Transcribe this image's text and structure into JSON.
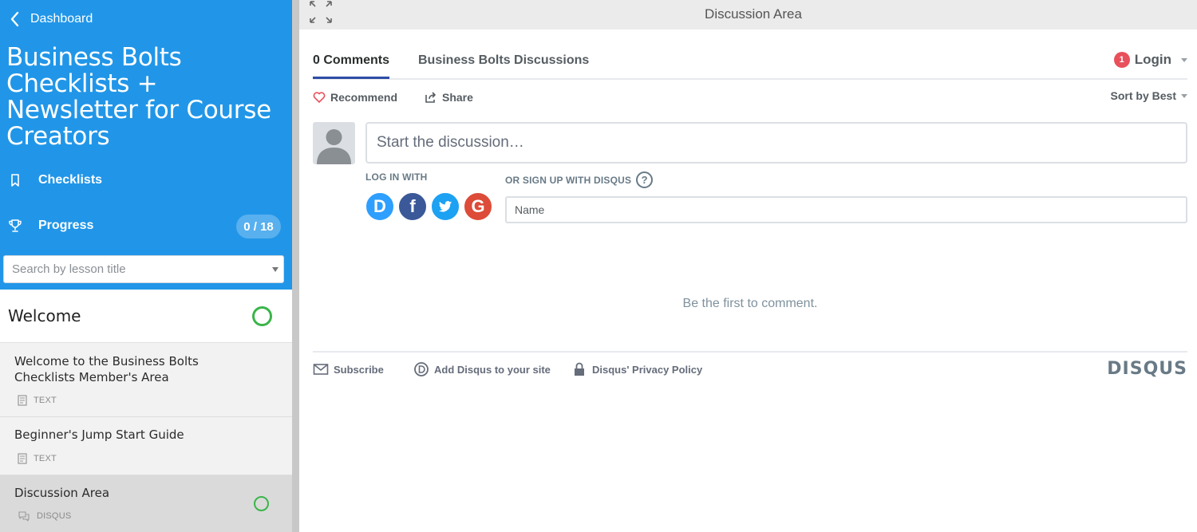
{
  "sidebar": {
    "back_label": "Dashboard",
    "course_title": "Business Bolts Checklists + Newsletter for Course Creators",
    "nav": {
      "checklists": "Checklists",
      "progress": "Progress",
      "progress_count": "0 / 18"
    },
    "search_placeholder": "Search by lesson title",
    "section": {
      "title": "Welcome"
    },
    "lessons": [
      {
        "title": "Welcome to the Business Bolts Checklists Member's Area",
        "type": "TEXT"
      },
      {
        "title": "Beginner's Jump Start Guide",
        "type": "TEXT"
      },
      {
        "title": "Discussion Area",
        "type": "DISQUS",
        "active": true
      }
    ],
    "colors": {
      "header_bg": "#2196e8",
      "complete_ring": "#3ab54a"
    }
  },
  "topbar": {
    "title": "Discussion Area"
  },
  "disqus": {
    "tabs": {
      "comments": "0 Comments",
      "site": "Business Bolts Discussions"
    },
    "login": {
      "badge": "1",
      "label": "Login"
    },
    "actions": {
      "recommend": "Recommend",
      "share": "Share",
      "sort": "Sort by Best"
    },
    "composer_placeholder": "Start the discussion…",
    "login_with": "LOG IN WITH",
    "social": {
      "disqus": "D",
      "facebook": "f",
      "twitter": "t",
      "google": "G"
    },
    "signup_label": "OR SIGN UP WITH DISQUS",
    "help": "?",
    "name_placeholder": "Name",
    "empty_message": "Be the first to comment.",
    "footer": {
      "subscribe": "Subscribe",
      "add": "Add Disqus to your site",
      "privacy": "Disqus' Privacy Policy",
      "logo": "DISQUS"
    }
  }
}
